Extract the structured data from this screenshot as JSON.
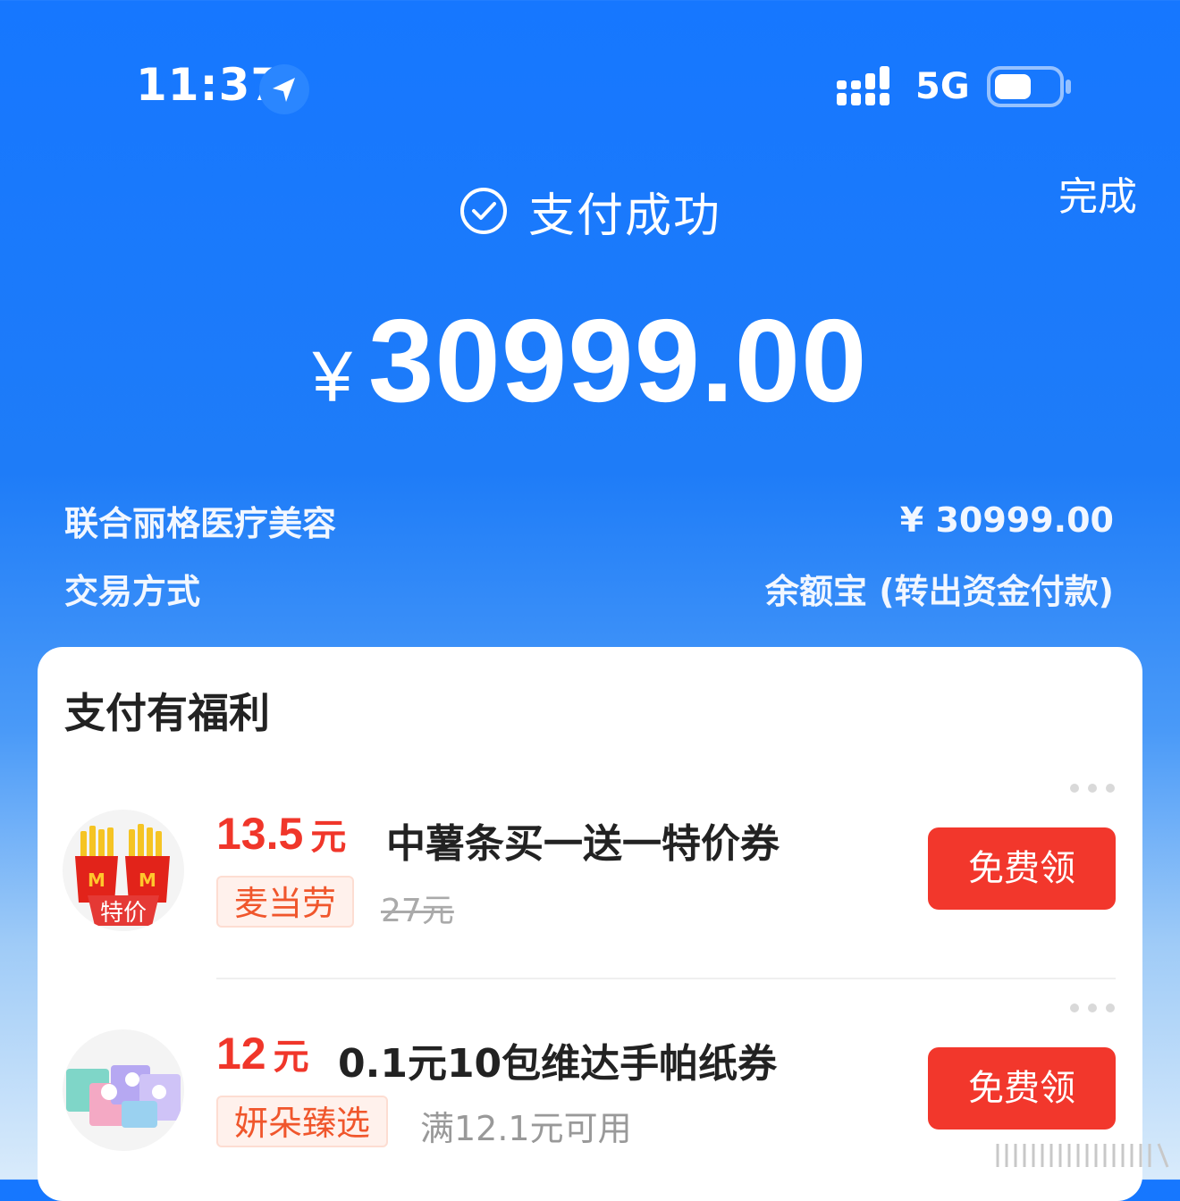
{
  "status_bar": {
    "time": "11:37",
    "location_icon": "location-arrow-icon",
    "signal_icon": "signal-icon",
    "network": "5G",
    "battery_icon": "battery-icon"
  },
  "header": {
    "done_label": "完成",
    "success_icon": "check-circle-icon",
    "success_label": "支付成功"
  },
  "amount": {
    "currency": "¥",
    "value": "30999.00"
  },
  "details": [
    {
      "label": "联合丽格医疗美容",
      "value": "¥ 30999.00"
    },
    {
      "label": "交易方式",
      "value": "余额宝 (转出资金付款)"
    }
  ],
  "benefits": {
    "title": "支付有福利",
    "items": [
      {
        "price": "13.5",
        "unit": "元",
        "title": "中薯条买一送一特价券",
        "tag": "麦当劳",
        "original_price": "27元",
        "badge": "特价",
        "button": "免费领",
        "thumb_icon": "fries-icon",
        "more_icon": "more-dots-icon"
      },
      {
        "price": "12",
        "unit": "元",
        "title": "0.1元10包维达手帕纸券",
        "tag": "妍朵臻选",
        "condition": "满12.1元可用",
        "button": "免费领",
        "thumb_icon": "tissue-pack-icon",
        "more_icon": "more-dots-icon"
      }
    ]
  },
  "colors": {
    "brand_blue": "#1677FF",
    "price_red": "#F0362A",
    "button_red": "#F2372C",
    "tag_orange": "#F0562C"
  }
}
